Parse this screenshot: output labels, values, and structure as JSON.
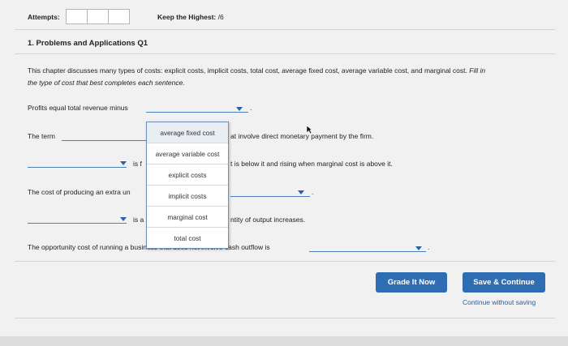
{
  "header": {
    "attempts_label": "Attempts:",
    "keep_highest_label": "Keep the Highest:",
    "keep_highest_value": "/6"
  },
  "question": {
    "title": "1. Problems and Applications Q1",
    "intro_line1": "This chapter discusses many types of costs: explicit costs, implicit costs, total cost, average fixed cost, average variable cost, and marginal cost.",
    "intro_fill": "Fill in",
    "intro_line2": "the type of cost that best completes each sentence."
  },
  "sentences": {
    "s1": "Profits equal total revenue minus",
    "s2_start": "The term",
    "s2_end": "at involve direct monetary payment by the firm.",
    "s3_mid": "is f",
    "s3_end": "t is below it and rising when marginal cost is above it.",
    "s4": "The cost of producing an extra un",
    "s5_mid": "is a",
    "s5_end": "ntity of output increases.",
    "s6": "The opportunity cost of running a business that does not involve cash outflow is",
    "period": "."
  },
  "dropdown": {
    "options": [
      "average fixed cost",
      "average variable cost",
      "explicit costs",
      "implicit costs",
      "marginal cost",
      "total cost"
    ]
  },
  "actions": {
    "grade_now": "Grade It Now",
    "save_continue": "Save & Continue",
    "continue_without": "Continue without saving"
  }
}
